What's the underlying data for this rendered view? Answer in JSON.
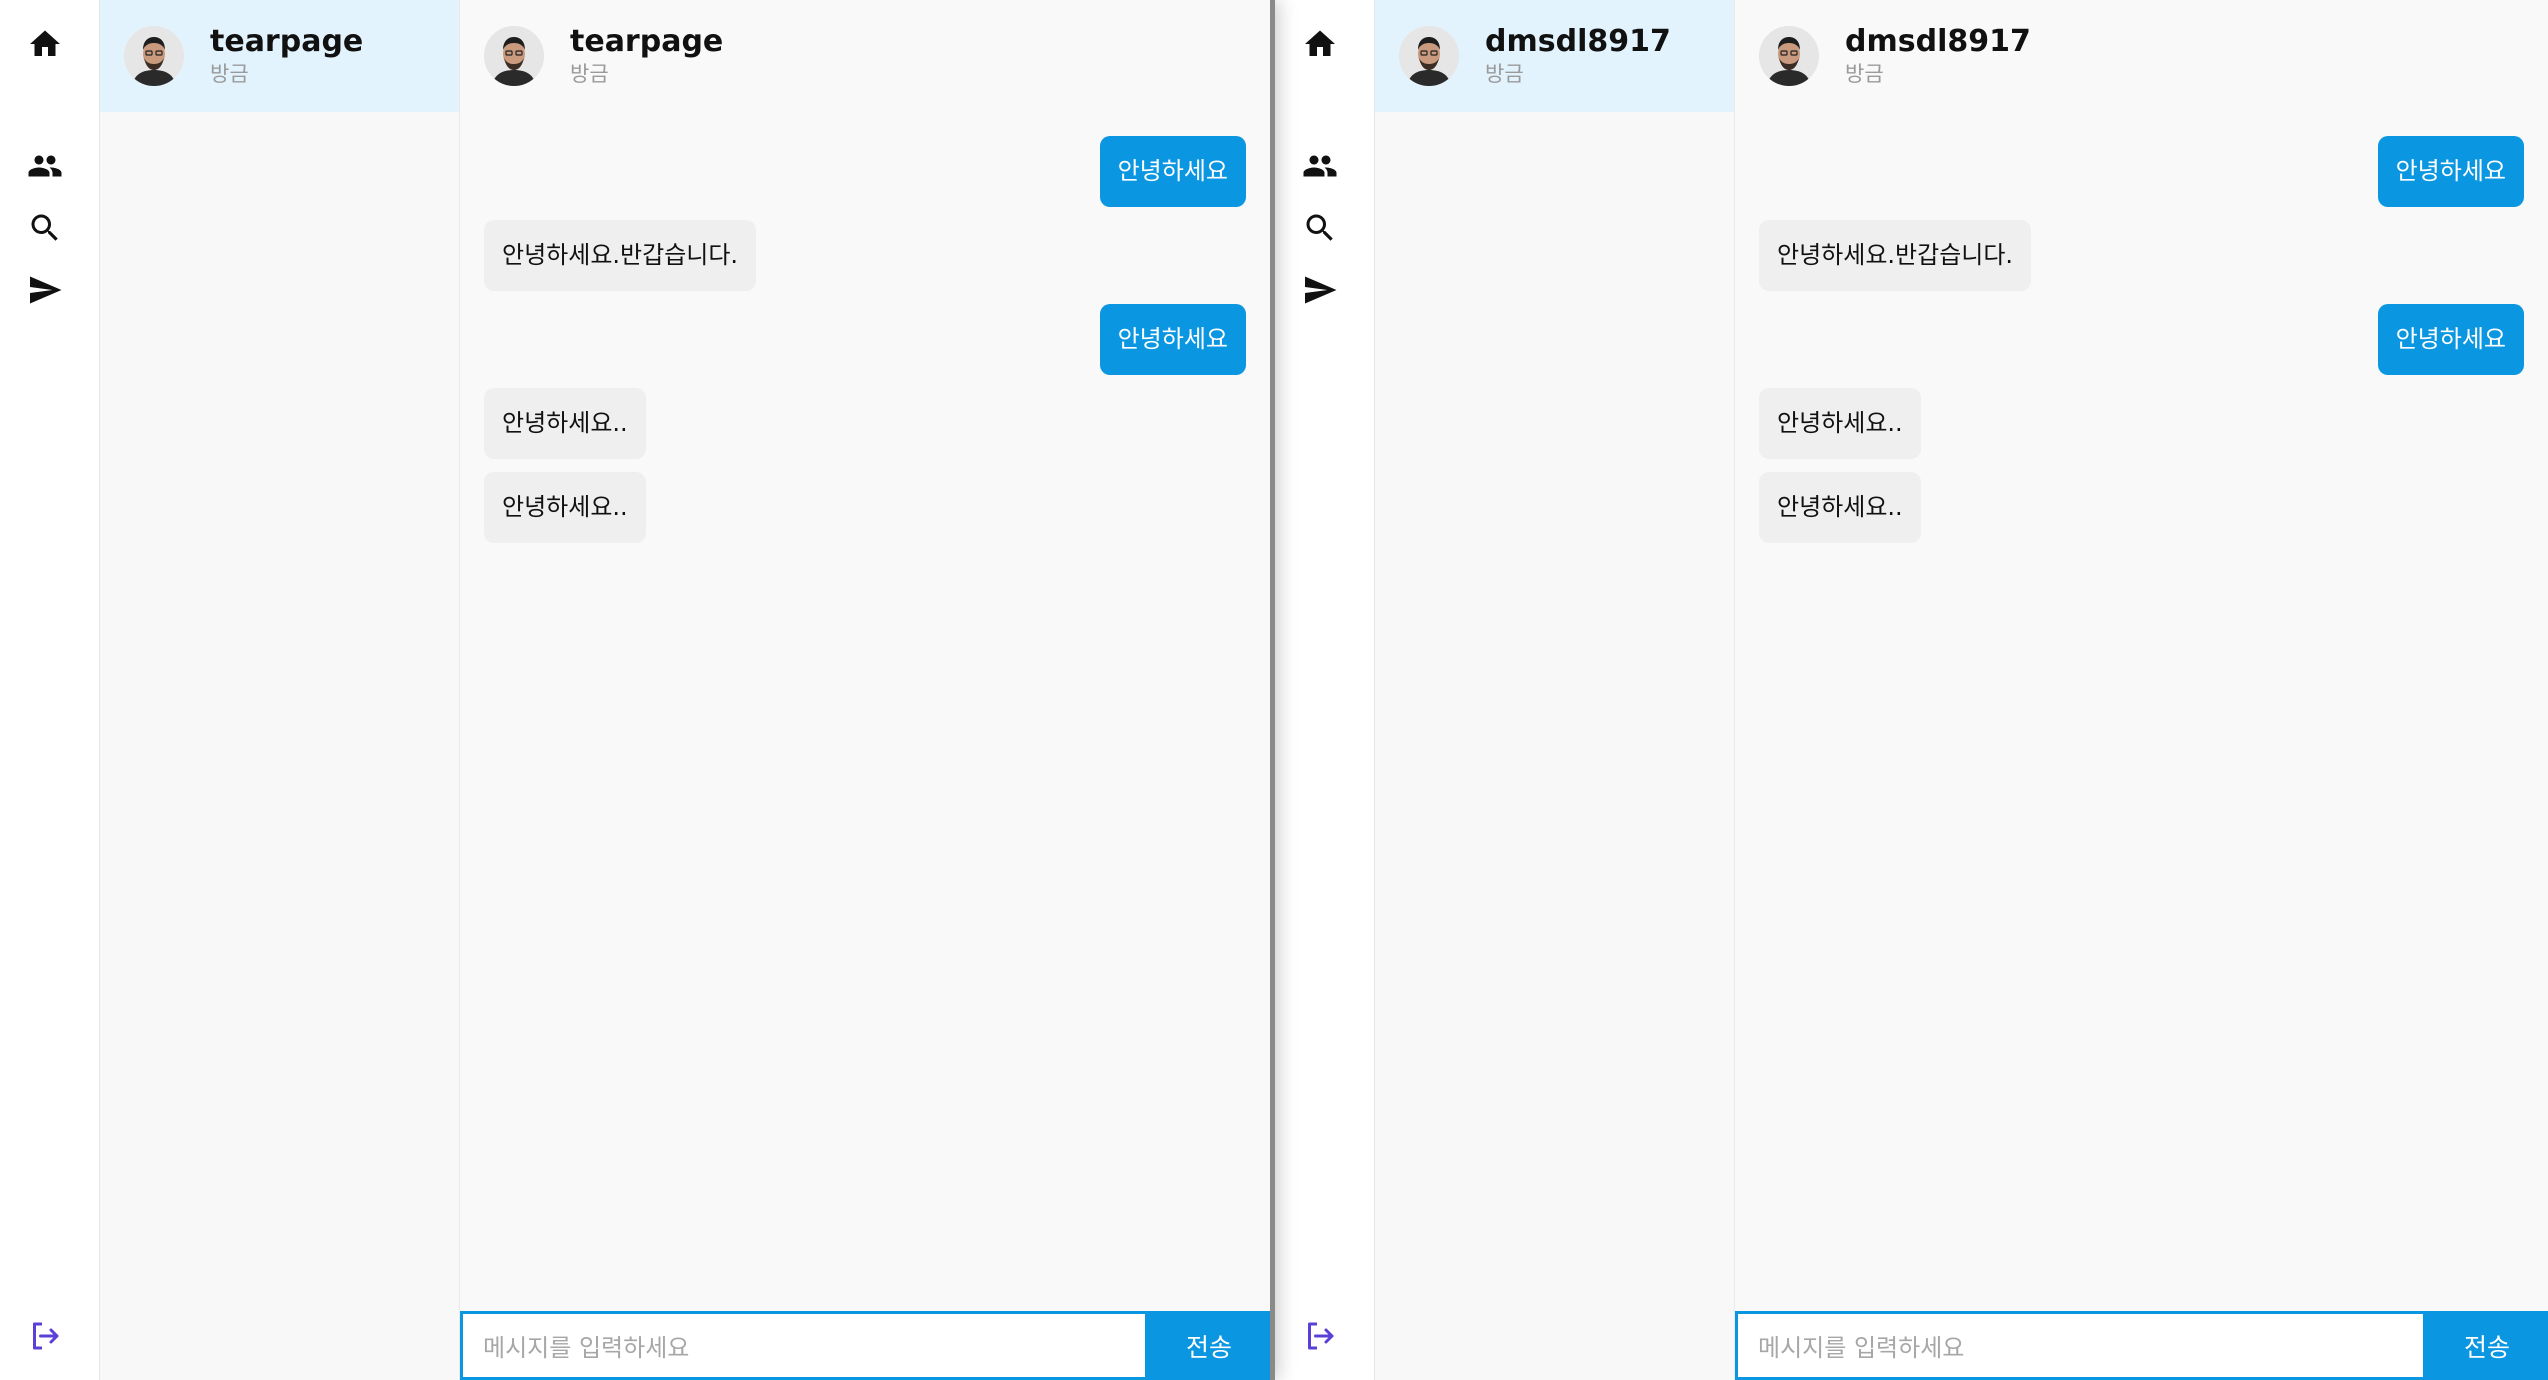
{
  "apps": [
    {
      "contact": {
        "name": "tearpage",
        "time": "방금"
      },
      "messages": [
        {
          "from": "me",
          "text": "안녕하세요"
        },
        {
          "from": "them",
          "text": "안녕하세요.반갑습니다."
        },
        {
          "from": "me",
          "text": "안녕하세요"
        },
        {
          "from": "them",
          "text": "안녕하세요.."
        },
        {
          "from": "them",
          "text": "안녕하세요.."
        }
      ],
      "composer": {
        "placeholder": "메시지를 입력하세요",
        "send_label": "전송"
      }
    },
    {
      "contact": {
        "name": "dmsdl8917",
        "time": "방금"
      },
      "messages": [
        {
          "from": "me",
          "text": "안녕하세요"
        },
        {
          "from": "them",
          "text": "안녕하세요.반갑습니다."
        },
        {
          "from": "me",
          "text": "안녕하세요"
        },
        {
          "from": "them",
          "text": "안녕하세요.."
        },
        {
          "from": "them",
          "text": "안녕하세요.."
        }
      ],
      "composer": {
        "placeholder": "메시지를 입력하세요",
        "send_label": "전송"
      }
    }
  ],
  "icons": {
    "nav": [
      "home-icon",
      "friends-icon",
      "search-icon",
      "send-icon"
    ],
    "bottom": "logout-icon"
  },
  "colors": {
    "accent": "#0a96e0",
    "active_room_bg": "#e3f3fd",
    "logout_icon": "#5b3fd6"
  }
}
